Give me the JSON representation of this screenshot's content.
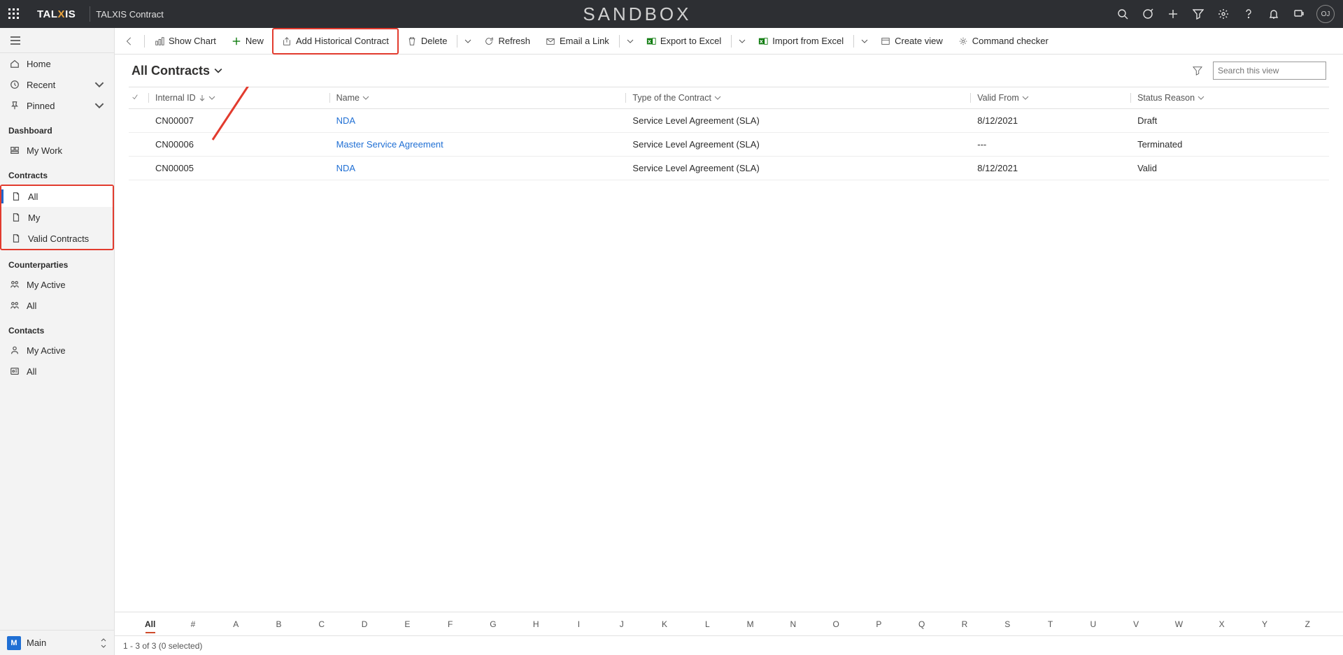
{
  "topbar": {
    "logo_prefix": "TAL",
    "logo_mid": "X",
    "logo_suffix": "IS",
    "app_name": "TALXIS Contract",
    "banner": "SANDBOX",
    "avatar_initials": "OJ"
  },
  "sidebar": {
    "home": "Home",
    "recent": "Recent",
    "pinned": "Pinned",
    "group_dashboard": "Dashboard",
    "my_work": "My Work",
    "group_contracts": "Contracts",
    "all": "All",
    "my": "My",
    "valid_contracts": "Valid Contracts",
    "group_counterparties": "Counterparties",
    "my_active": "My Active",
    "cp_all": "All",
    "group_contacts": "Contacts",
    "ct_my_active": "My Active",
    "ct_all": "All",
    "area_badge": "M",
    "area_label": "Main"
  },
  "cmdbar": {
    "back": "",
    "show_chart": "Show Chart",
    "new": "New",
    "add_historical": "Add Historical Contract",
    "delete": "Delete",
    "refresh": "Refresh",
    "email_link": "Email a Link",
    "export_excel": "Export to Excel",
    "import_excel": "Import from Excel",
    "create_view": "Create view",
    "cmd_checker": "Command checker"
  },
  "view": {
    "title": "All Contracts",
    "search_placeholder": "Search this view"
  },
  "grid": {
    "columns": {
      "internal_id": "Internal ID",
      "name": "Name",
      "type": "Type of the Contract",
      "valid_from": "Valid From",
      "status": "Status Reason"
    },
    "rows": [
      {
        "id": "CN00007",
        "name": "NDA",
        "type": "Service Level Agreement (SLA)",
        "valid_from": "8/12/2021",
        "status": "Draft"
      },
      {
        "id": "CN00006",
        "name": "Master Service Agreement",
        "type": "Service Level Agreement (SLA)",
        "valid_from": "---",
        "status": "Terminated"
      },
      {
        "id": "CN00005",
        "name": "NDA",
        "type": "Service Level Agreement (SLA)",
        "valid_from": "8/12/2021",
        "status": "Valid"
      }
    ]
  },
  "alphabar": [
    "All",
    "#",
    "A",
    "B",
    "C",
    "D",
    "E",
    "F",
    "G",
    "H",
    "I",
    "J",
    "K",
    "L",
    "M",
    "N",
    "O",
    "P",
    "Q",
    "R",
    "S",
    "T",
    "U",
    "V",
    "W",
    "X",
    "Y",
    "Z"
  ],
  "statusbar": {
    "info": "1 - 3 of 3 (0 selected)"
  }
}
